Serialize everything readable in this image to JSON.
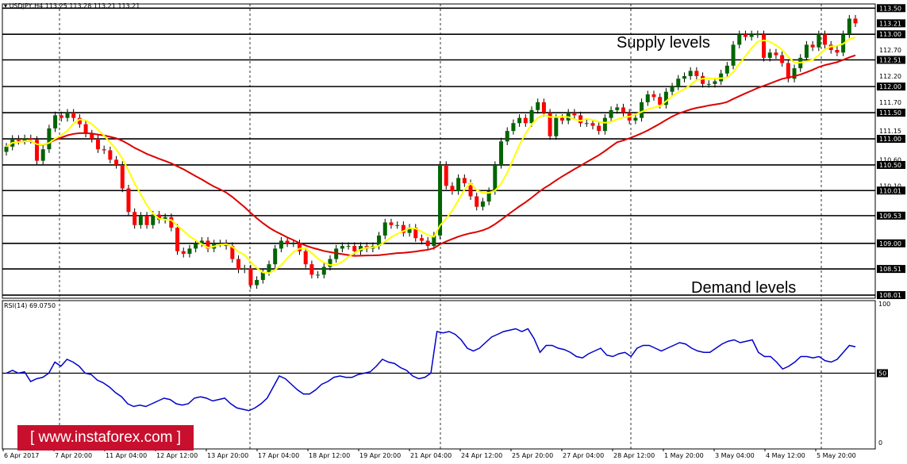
{
  "header": {
    "symbol_label": "USDJPY,H4",
    "ohlc_label": "113.25 113.28 113.21 113.21"
  },
  "annotations": {
    "supply": "Supply levels",
    "demand": "Demand levels"
  },
  "watermark": "[ www.instaforex.com ]",
  "colors": {
    "bull": "#006400",
    "bear": "#ff0000",
    "wick": "#000000",
    "ma_fast": "#ffff00",
    "ma_slow": "#dd0000",
    "rsi": "#0000cc",
    "level_line": "#000000",
    "grid": "#000000",
    "logo_bg": "#c8102e"
  },
  "chart_data": [
    {
      "type": "candlestick",
      "title": "USDJPY,H4",
      "ylim": [
        107.95,
        113.58
      ],
      "price_ticks": [
        "113.50",
        "113.21",
        "113.00",
        "112.70",
        "112.51",
        "112.20",
        "112.00",
        "111.70",
        "111.50",
        "111.15",
        "111.00",
        "110.60",
        "110.50",
        "110.10",
        "110.01",
        "109.53",
        "109.00",
        "108.51",
        "108.01"
      ],
      "horizontal_levels": [
        113.5,
        113.0,
        112.51,
        112.0,
        111.5,
        111.0,
        110.5,
        110.01,
        109.53,
        109.0,
        108.51,
        108.01
      ],
      "current_price": 113.21,
      "x_labels": [
        "6 Apr 2017",
        "7 Apr 20:00",
        "11 Apr 04:00",
        "12 Apr 12:00",
        "13 Apr 20:00",
        "17 Apr 04:00",
        "18 Apr 12:00",
        "19 Apr 20:00",
        "21 Apr 04:00",
        "24 Apr 12:00",
        "25 Apr 20:00",
        "27 Apr 04:00",
        "28 Apr 12:00",
        "1 May 20:00",
        "3 May 04:00",
        "4 May 12:00",
        "5 May 20:00"
      ],
      "closes": [
        110.85,
        111.0,
        110.96,
        111.01,
        110.98,
        110.58,
        110.8,
        111.2,
        111.45,
        111.4,
        111.5,
        111.4,
        111.28,
        111.1,
        111.0,
        110.8,
        110.78,
        110.6,
        110.5,
        110.05,
        109.6,
        109.35,
        109.53,
        109.35,
        109.55,
        109.45,
        109.5,
        109.3,
        108.85,
        108.8,
        108.9,
        109.0,
        109.05,
        108.9,
        109.0,
        109.0,
        108.95,
        108.7,
        108.5,
        108.52,
        108.2,
        108.3,
        108.45,
        108.6,
        108.9,
        109.05,
        109.0,
        109.0,
        108.85,
        108.6,
        108.4,
        108.4,
        108.55,
        108.7,
        108.9,
        108.95,
        108.95,
        108.85,
        108.95,
        108.9,
        108.95,
        109.15,
        109.4,
        109.35,
        109.35,
        109.2,
        109.3,
        109.1,
        109.05,
        108.95,
        109.15,
        110.5,
        110.1,
        110.0,
        110.25,
        110.15,
        109.9,
        109.7,
        109.8,
        110.0,
        110.5,
        110.95,
        111.15,
        111.3,
        111.4,
        111.3,
        111.55,
        111.7,
        111.5,
        111.05,
        111.4,
        111.35,
        111.5,
        111.45,
        111.3,
        111.3,
        111.25,
        111.15,
        111.4,
        111.55,
        111.6,
        111.5,
        111.35,
        111.4,
        111.7,
        111.85,
        111.8,
        111.65,
        111.9,
        112.0,
        112.15,
        112.2,
        112.3,
        112.2,
        112.05,
        112.05,
        112.1,
        112.25,
        112.4,
        112.8,
        113.0,
        112.95,
        113.0,
        113.0,
        112.55,
        112.65,
        112.6,
        112.45,
        112.15,
        112.35,
        112.55,
        112.8,
        112.75,
        113.0,
        112.8,
        112.7,
        112.65,
        113.0,
        113.3,
        113.21
      ]
    },
    {
      "type": "line",
      "title": "RSI(14) 69.0750",
      "ylim": [
        0,
        100
      ],
      "y_ticks": [
        "100",
        "50",
        "0"
      ],
      "reference_level": 50,
      "series": [
        {
          "name": "RSI(14)",
          "values": [
            50,
            52,
            50,
            51,
            44,
            46,
            47,
            50,
            58,
            55,
            60,
            58,
            55,
            50,
            49,
            45,
            43,
            40,
            36,
            33,
            28,
            26,
            27,
            26,
            28,
            30,
            32,
            31,
            28,
            27,
            28,
            32,
            33,
            32,
            30,
            31,
            32,
            28,
            25,
            24,
            23,
            25,
            28,
            32,
            40,
            48,
            46,
            42,
            38,
            35,
            35,
            38,
            42,
            44,
            47,
            48,
            47,
            47,
            49,
            50,
            51,
            55,
            60,
            58,
            57,
            54,
            52,
            48,
            46,
            47,
            50,
            80,
            79,
            80,
            78,
            74,
            68,
            66,
            68,
            72,
            76,
            78,
            80,
            81,
            82,
            80,
            82,
            75,
            65,
            70,
            70,
            68,
            67,
            65,
            62,
            61,
            64,
            66,
            68,
            63,
            62,
            64,
            65,
            62,
            68,
            70,
            70,
            68,
            66,
            68,
            70,
            72,
            71,
            68,
            66,
            65,
            65,
            68,
            71,
            73,
            74,
            72,
            73,
            74,
            65,
            62,
            62,
            58,
            53,
            55,
            58,
            62,
            62,
            61,
            62,
            59,
            58,
            60,
            65,
            70,
            69
          ]
        }
      ]
    }
  ]
}
